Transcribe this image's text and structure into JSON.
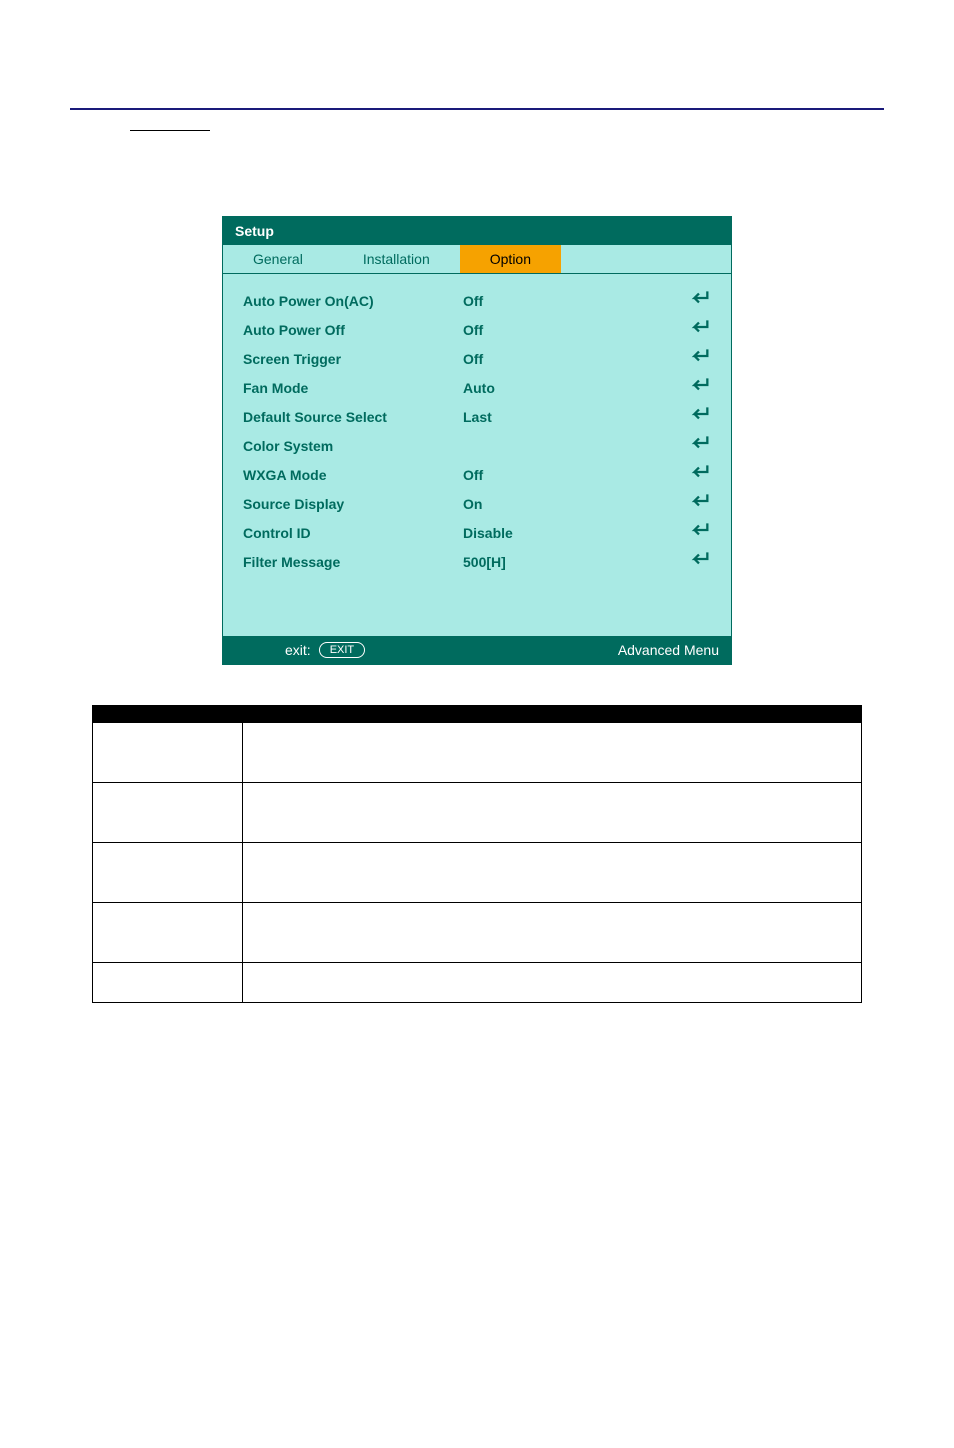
{
  "menu": {
    "title": "Setup",
    "tabs": [
      {
        "label": "General",
        "active": false
      },
      {
        "label": "Installation",
        "active": false
      },
      {
        "label": "Option",
        "active": true
      }
    ],
    "rows": [
      {
        "label": "Auto Power On(AC)",
        "value": "Off"
      },
      {
        "label": "Auto Power Off",
        "value": "Off"
      },
      {
        "label": "Screen Trigger",
        "value": "Off"
      },
      {
        "label": "Fan Mode",
        "value": "Auto"
      },
      {
        "label": "Default Source Select",
        "value": "Last"
      },
      {
        "label": "Color System",
        "value": ""
      },
      {
        "label": "WXGA Mode",
        "value": "Off"
      },
      {
        "label": "Source Display",
        "value": "On"
      },
      {
        "label": "Control ID",
        "value": "Disable"
      },
      {
        "label": "Filter Message",
        "value": "500[H]"
      }
    ],
    "footer": {
      "exit_label": "exit:",
      "exit_badge": "EXIT",
      "menu_mode": "Advanced Menu"
    }
  },
  "spec_table": {
    "headers": [
      "",
      ""
    ],
    "rows": [
      {
        "item": "",
        "desc": ""
      },
      {
        "item": "",
        "desc": ""
      },
      {
        "item": "",
        "desc": ""
      },
      {
        "item": "",
        "desc": ""
      },
      {
        "item": "",
        "desc": ""
      }
    ]
  }
}
